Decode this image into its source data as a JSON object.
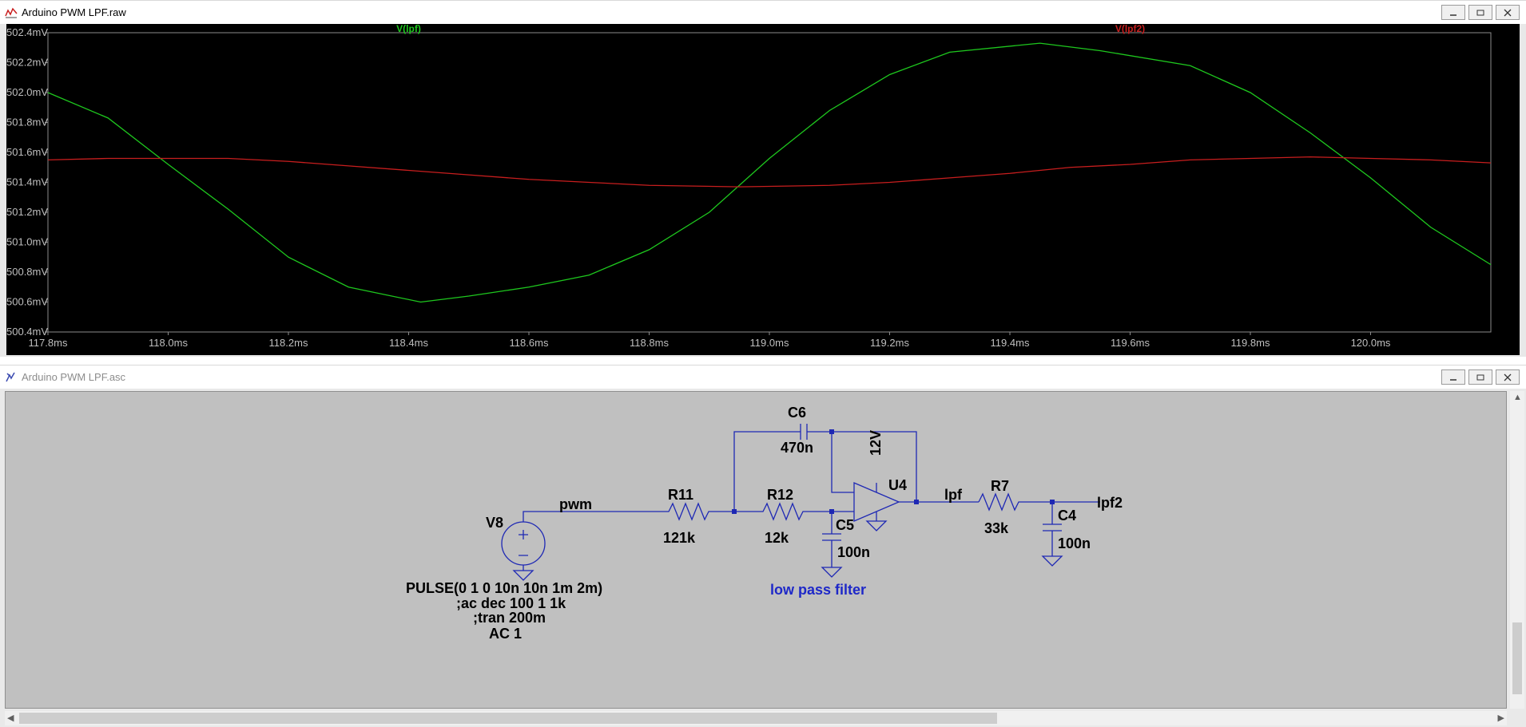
{
  "waveform_window": {
    "title": "Arduino PWM LPF.raw",
    "chart_data": {
      "type": "line",
      "x_unit": "ms",
      "y_unit": "mV",
      "xlim": [
        117.8,
        120.2
      ],
      "ylim": [
        500.4,
        502.4
      ],
      "x_ticks": [
        "117.8ms",
        "118.0ms",
        "118.2ms",
        "118.4ms",
        "118.6ms",
        "118.8ms",
        "119.0ms",
        "119.2ms",
        "119.4ms",
        "119.6ms",
        "119.8ms",
        "120.0ms"
      ],
      "y_ticks": [
        "502.4mV",
        "502.2mV",
        "502.0mV",
        "501.8mV",
        "501.6mV",
        "501.4mV",
        "501.2mV",
        "501.0mV",
        "500.8mV",
        "500.6mV",
        "500.4mV"
      ],
      "background": "#000000",
      "series": [
        {
          "name": "V(lpf)",
          "color": "#1ec81e",
          "x": [
            117.8,
            117.9,
            118.0,
            118.1,
            118.2,
            118.3,
            118.42,
            118.5,
            118.6,
            118.7,
            118.8,
            118.9,
            119.0,
            119.1,
            119.2,
            119.3,
            119.45,
            119.55,
            119.7,
            119.8,
            119.9,
            120.0,
            120.1,
            120.2
          ],
          "y": [
            502.0,
            501.83,
            501.52,
            501.22,
            500.9,
            500.7,
            500.6,
            500.64,
            500.7,
            500.78,
            500.95,
            501.2,
            501.56,
            501.88,
            502.12,
            502.27,
            502.33,
            502.28,
            502.18,
            502.0,
            501.73,
            501.43,
            501.1,
            500.85
          ]
        },
        {
          "name": "V(lpf2)",
          "color": "#c81e1e",
          "x": [
            117.8,
            117.9,
            118.0,
            118.1,
            118.2,
            118.3,
            118.4,
            118.5,
            118.6,
            118.7,
            118.8,
            118.95,
            119.1,
            119.2,
            119.3,
            119.4,
            119.5,
            119.6,
            119.7,
            119.8,
            119.9,
            120.0,
            120.1,
            120.2
          ],
          "y": [
            501.55,
            501.56,
            501.56,
            501.56,
            501.54,
            501.51,
            501.48,
            501.45,
            501.42,
            501.4,
            501.38,
            501.37,
            501.38,
            501.4,
            501.43,
            501.46,
            501.5,
            501.52,
            501.55,
            501.56,
            501.57,
            501.56,
            501.55,
            501.53
          ]
        }
      ]
    }
  },
  "schematic_window": {
    "title": "Arduino PWM LPF.asc",
    "wire_color": "#1e28b4",
    "text_color": "#000000",
    "comment_color": "#1e28c8",
    "components": {
      "v8": {
        "ref": "V8",
        "value": "PULSE(0 1 0 10n 10n 1m 2m)",
        "ac": "AC 1"
      },
      "r11": {
        "ref": "R11",
        "value": "121k"
      },
      "r12": {
        "ref": "R12",
        "value": "12k"
      },
      "c5": {
        "ref": "C5",
        "value": "100n"
      },
      "c6": {
        "ref": "C6",
        "value": "470n"
      },
      "u4": {
        "ref": "U4",
        "supply": "12V"
      },
      "r7": {
        "ref": "R7",
        "value": "33k"
      },
      "c4": {
        "ref": "C4",
        "value": "100n"
      }
    },
    "nets": {
      "pwm": "pwm",
      "lpf": "lpf",
      "lpf2": "lpf2"
    },
    "directives": {
      "ac": ";ac dec 100 1 1k",
      "tran": ";tran 200m"
    },
    "comment": "low pass filter"
  }
}
